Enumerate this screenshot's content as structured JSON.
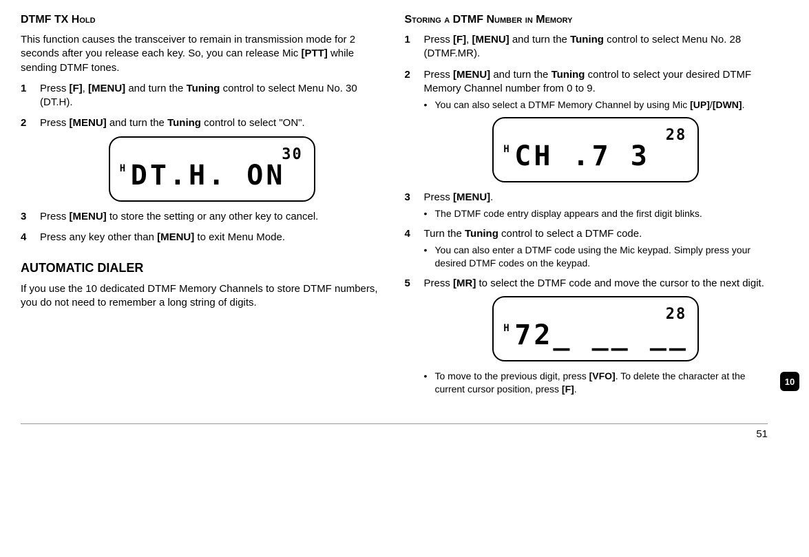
{
  "left": {
    "sec1_title": "DTMF TX Hold",
    "sec1_intro_a": "This function causes the transceiver to remain in transmission mode for 2 seconds after you release each key.  So, you can release Mic ",
    "sec1_intro_b": " while sending DTMF tones.",
    "ptt": "[PTT]",
    "steps1": {
      "s1a": "Press ",
      "s1_f": "[F]",
      "s1b": ", ",
      "s1_menu": "[MENU]",
      "s1c": " and turn the ",
      "s1_tuning": "Tuning",
      "s1d": " control to select Menu No. 30 (DT.H).",
      "s2a": "Press ",
      "s2_menu": "[MENU]",
      "s2b": " and turn the ",
      "s2_tuning": "Tuning",
      "s2c": " control to select \"ON\".",
      "s3a": "Press ",
      "s3_menu": "[MENU]",
      "s3b": " to store the setting or any other key to cancel.",
      "s4a": "Press any key other than ",
      "s4_menu": "[MENU]",
      "s4b": " to exit Menu Mode."
    },
    "lcd1": {
      "main": "DT.H. ON",
      "small": "30"
    },
    "sec2_title": "AUTOMATIC DIALER",
    "sec2_text": "If you use the 10 dedicated DTMF Memory Channels to store DTMF numbers, you do not need to remember a long string of digits."
  },
  "right": {
    "sec1_title": "Storing a DTMF Number in Memory",
    "steps": {
      "s1a": "Press ",
      "s1_f": "[F]",
      "s1b": ", ",
      "s1_menu": "[MENU]",
      "s1c": " and turn the ",
      "s1_tuning": "Tuning",
      "s1d": " control to select Menu No. 28 (DTMF.MR).",
      "s2a": "Press ",
      "s2_menu": "[MENU]",
      "s2b": " and turn the ",
      "s2_tuning": "Tuning",
      "s2c": " control to select your desired DTMF Memory Channel number from 0 to 9.",
      "s2_bullet_a": "You can also select a DTMF Memory Channel by using Mic ",
      "s2_bullet_up": "[UP]",
      "s2_bullet_sl": "/",
      "s2_bullet_dwn": "[DWN]",
      "s2_bullet_b": ".",
      "s3a": "Press ",
      "s3_menu": "[MENU]",
      "s3b": ".",
      "s3_bullet": "The DTMF code entry display appears and the first digit blinks.",
      "s4a": "Turn the ",
      "s4_tuning": "Tuning",
      "s4b": " control to select a DTMF code.",
      "s4_bullet": "You can also enter a DTMF code using the Mic keypad. Simply press your desired DTMF codes on the keypad.",
      "s5a": "Press ",
      "s5_mr": "[MR]",
      "s5b": " to select the DTMF code and move the cursor to the next digit.",
      "s5_bullet_a": "To move to the previous digit, press ",
      "s5_bullet_vfo": "[VFO]",
      "s5_bullet_b": ".  To delete the character at the current cursor position, press ",
      "s5_bullet_f": "[F]",
      "s5_bullet_c": "."
    },
    "lcd2": {
      "main": "CH .7  3",
      "small": "28"
    },
    "lcd3": {
      "main": "72_ __ __",
      "small": "28"
    }
  },
  "page_number": "51",
  "tab": "10"
}
